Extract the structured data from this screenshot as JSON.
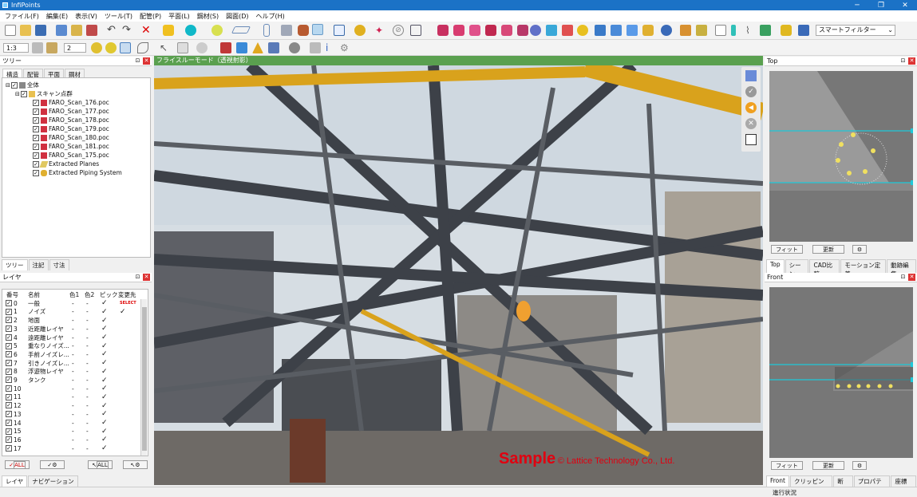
{
  "app": {
    "title": "InfiPoints",
    "win_min": "─",
    "win_max": "❐",
    "win_close": "✕"
  },
  "menu": [
    "ファイル(F)",
    "編集(E)",
    "表示(V)",
    "ツール(T)",
    "配管(P)",
    "平面(L)",
    "鋼材(S)",
    "図面(D)",
    "ヘルプ(H)"
  ],
  "toolbar": {
    "filter_label": "スマートフィルター",
    "scale_value": "1:3",
    "step_value": "2"
  },
  "tree_panel": {
    "title": "ツリー",
    "tabs": [
      "構造",
      "配管",
      "平面",
      "鋼材"
    ],
    "root": "全体",
    "group": "スキャン点群",
    "scans": [
      "FARO_Scan_176.poc",
      "FARO_Scan_177.poc",
      "FARO_Scan_178.poc",
      "FARO_Scan_179.poc",
      "FARO_Scan_180.poc",
      "FARO_Scan_181.poc",
      "FARO_Scan_175.poc"
    ],
    "extras": [
      "Extracted Planes",
      "Extracted Piping System"
    ],
    "bottom_tabs": [
      "ツリー",
      "注記",
      "寸法"
    ]
  },
  "layer_panel": {
    "title": "レイヤ",
    "headers": [
      "番号",
      "名前",
      "色1",
      "色2",
      "ピック",
      "変更先"
    ],
    "rows": [
      {
        "num": "0",
        "name": "一般",
        "c1": "-",
        "c2": "-",
        "pick": "✓",
        "dest": "SELECT"
      },
      {
        "num": "1",
        "name": "ノイズ",
        "c1": "-",
        "c2": "-",
        "pick": "✓",
        "dest": "✓"
      },
      {
        "num": "2",
        "name": "地面",
        "c1": "-",
        "c2": "-",
        "pick": "✓",
        "dest": ""
      },
      {
        "num": "3",
        "name": "近距離レイヤ",
        "c1": "-",
        "c2": "-",
        "pick": "✓",
        "dest": ""
      },
      {
        "num": "4",
        "name": "遠距離レイヤ",
        "c1": "-",
        "c2": "-",
        "pick": "✓",
        "dest": ""
      },
      {
        "num": "5",
        "name": "重なりノイズ...",
        "c1": "-",
        "c2": "-",
        "pick": "✓",
        "dest": ""
      },
      {
        "num": "6",
        "name": "手前ノイズレ...",
        "c1": "-",
        "c2": "-",
        "pick": "✓",
        "dest": ""
      },
      {
        "num": "7",
        "name": "引きノイズレ...",
        "c1": "-",
        "c2": "-",
        "pick": "✓",
        "dest": ""
      },
      {
        "num": "8",
        "name": "浮遊物レイヤ",
        "c1": "-",
        "c2": "-",
        "pick": "✓",
        "dest": ""
      },
      {
        "num": "9",
        "name": "タンク",
        "c1": "-",
        "c2": "-",
        "pick": "✓",
        "dest": ""
      },
      {
        "num": "10",
        "name": "",
        "c1": "-",
        "c2": "-",
        "pick": "✓",
        "dest": ""
      },
      {
        "num": "11",
        "name": "",
        "c1": "-",
        "c2": "-",
        "pick": "✓",
        "dest": ""
      },
      {
        "num": "12",
        "name": "",
        "c1": "-",
        "c2": "-",
        "pick": "✓",
        "dest": ""
      },
      {
        "num": "13",
        "name": "",
        "c1": "-",
        "c2": "-",
        "pick": "✓",
        "dest": ""
      },
      {
        "num": "14",
        "name": "",
        "c1": "-",
        "c2": "-",
        "pick": "✓",
        "dest": ""
      },
      {
        "num": "15",
        "name": "",
        "c1": "-",
        "c2": "-",
        "pick": "✓",
        "dest": ""
      },
      {
        "num": "16",
        "name": "",
        "c1": "-",
        "c2": "-",
        "pick": "✓",
        "dest": ""
      },
      {
        "num": "17",
        "name": "",
        "c1": "-",
        "c2": "-",
        "pick": "✓",
        "dest": ""
      }
    ],
    "buttons": [
      "ALL",
      "",
      "ALL",
      ""
    ],
    "bottom_tabs": [
      "レイヤ",
      "ナビゲーション"
    ]
  },
  "viewport": {
    "title": "フライスルーモード（透視射影）",
    "watermark_main": "Sample",
    "watermark_sub": "© Lattice Technology Co., Ltd."
  },
  "top_panel": {
    "title": "Top",
    "fit": "フィット",
    "update": "更新",
    "tabs": [
      "Top",
      "シーン",
      "CAD比較",
      "モーション定義",
      "動跡編集"
    ]
  },
  "front_panel": {
    "title": "Front",
    "fit": "フィット",
    "update": "更新",
    "tabs": [
      "Front",
      "クリッピング",
      "断面",
      "プロパティ",
      "座標系"
    ]
  },
  "status": {
    "progress_label": "進行状況"
  },
  "colors": {
    "accent": "#1b72c6",
    "viewport_header": "#5aa04f",
    "cyan_line": "#1ec8d8",
    "beam_yellow": "#d9a21c"
  }
}
